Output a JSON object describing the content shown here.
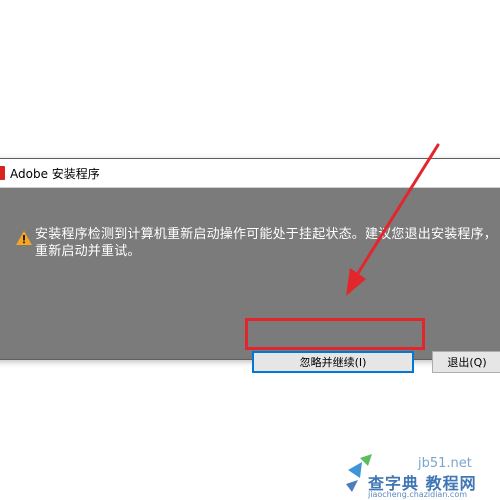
{
  "dialog": {
    "title": "Adobe 安装程序",
    "message": "安装程序检测到计算机重新启动操作可能处于挂起状态。建议您退出安装程序，重新启动并重试。",
    "buttons": {
      "ignore_continue": "忽略并继续(I)",
      "exit": "退出(Q)"
    },
    "icons": {
      "app": "adobe-icon",
      "warning": "warning-icon"
    }
  },
  "annotation": {
    "highlight_color": "#e3262b"
  },
  "watermark": {
    "site": "jb51.net",
    "name": "查字典 教程网",
    "url": "jiaocheng.chazidian.com"
  },
  "colors": {
    "dialog_body": "#7b7b7b",
    "accent_focus": "#0078d7",
    "warning": "#f5a623"
  }
}
